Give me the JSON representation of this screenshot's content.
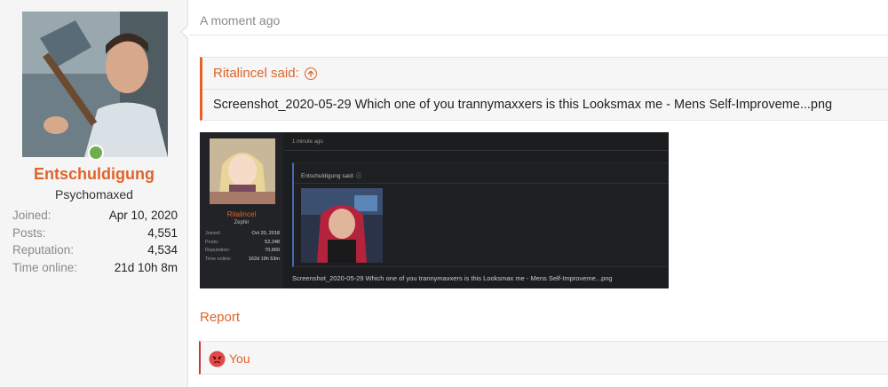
{
  "user": {
    "name": "Entschuldigung",
    "title": "Psychomaxed",
    "stats": [
      {
        "label": "Joined:",
        "value": "Apr 10, 2020"
      },
      {
        "label": "Posts:",
        "value": "4,551"
      },
      {
        "label": "Reputation:",
        "value": "4,534"
      },
      {
        "label": "Time online:",
        "value": "21d 10h 8m"
      }
    ]
  },
  "post": {
    "timestamp": "A moment ago",
    "quote_author": "Ritalincel said:",
    "quote_text": "Screenshot_2020-05-29 Which one of you trannymaxxers is this Looksmax me - Mens Self-Improveme...png"
  },
  "embed": {
    "user_name": "Ritalincel",
    "user_title": "Zephir",
    "stats": [
      {
        "label": "Joined:",
        "value": "Oct 20, 2018"
      },
      {
        "label": "Posts:",
        "value": "52,248"
      },
      {
        "label": "Reputation:",
        "value": "70,669"
      },
      {
        "label": "Time online:",
        "value": "162d 19h 53m"
      }
    ],
    "timestamp": "1 minute ago",
    "quote_author": "Entschuldigung said: ⓘ",
    "caption": "Screenshot_2020-05-29 Which one of you trannymaxxers is this Looksmax me - Mens Self-Improveme...png"
  },
  "actions": {
    "report": "Report"
  },
  "reactions": {
    "icon": "angry-face-icon",
    "text": "You"
  },
  "colors": {
    "accent": "#e0632a",
    "online": "#6fae4a",
    "reaction_bar": "#c23b3b"
  }
}
